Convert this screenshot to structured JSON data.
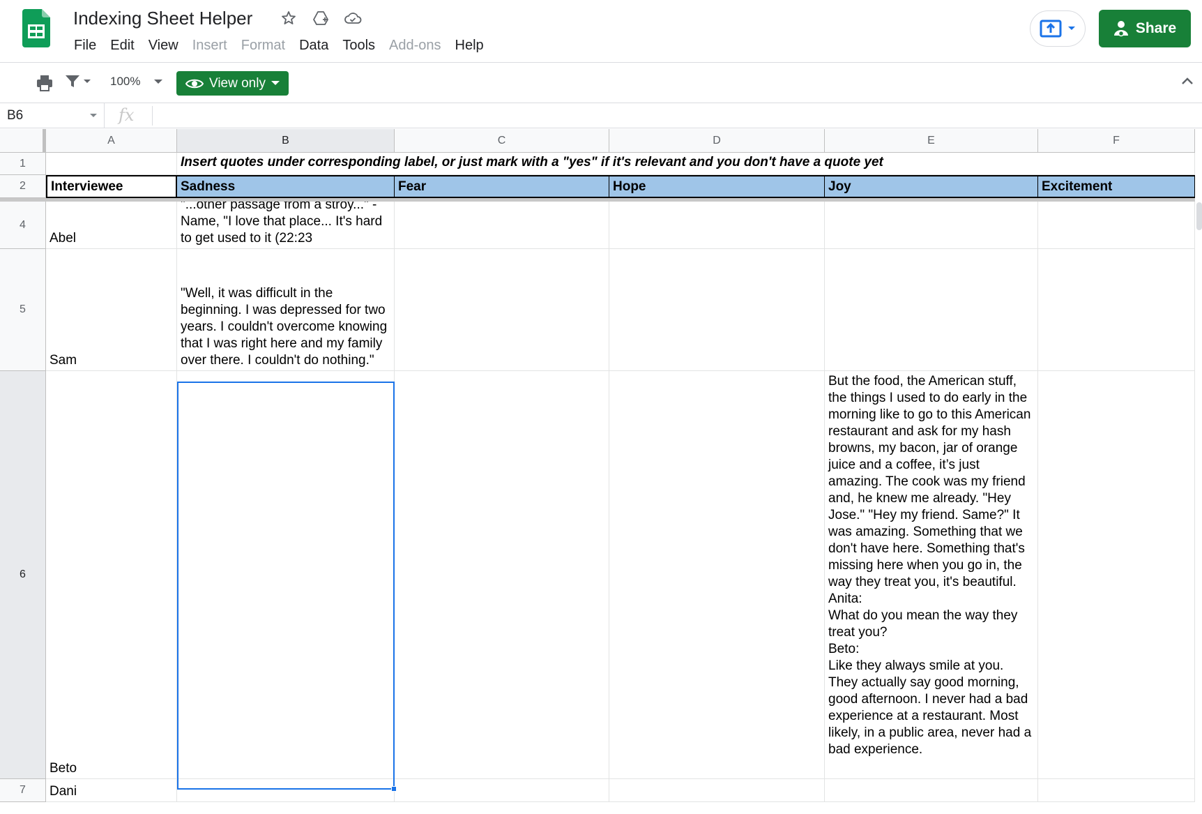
{
  "app": {
    "title": "Indexing Sheet Helper",
    "menus": [
      {
        "label": "File",
        "enabled": true
      },
      {
        "label": "Edit",
        "enabled": true
      },
      {
        "label": "View",
        "enabled": true
      },
      {
        "label": "Insert",
        "enabled": false
      },
      {
        "label": "Format",
        "enabled": false
      },
      {
        "label": "Data",
        "enabled": true
      },
      {
        "label": "Tools",
        "enabled": true
      },
      {
        "label": "Add-ons",
        "enabled": false
      },
      {
        "label": "Help",
        "enabled": true
      }
    ],
    "share_label": "Share",
    "brand_color": "#188038",
    "accent_color": "#1a73e8"
  },
  "toolbar": {
    "zoom": "100%",
    "mode_label": "View only"
  },
  "formula_bar": {
    "cell_ref": "B6",
    "fx_label": "fx",
    "formula": ""
  },
  "sheet": {
    "columns": [
      "A",
      "B",
      "C",
      "D",
      "E",
      "F"
    ],
    "selected_column": "B",
    "row_numbers": [
      "1",
      "2",
      "4",
      "5",
      "6",
      "7"
    ],
    "selected_row": "6",
    "row1_note": "Insert quotes under corresponding label,  or just mark with a \"yes\" if it's relevant and you don't have a quote yet",
    "headers": {
      "a": "Interviewee",
      "b": "Sadness",
      "c": "Fear",
      "d": "Hope",
      "e": "Joy",
      "f": "Excitement"
    },
    "rows": [
      {
        "a": "Abel",
        "b": "\"...other passage from a stroy...\" - Name, \"I love that place... It's hard to get used to it (22:23",
        "e": ""
      },
      {
        "a": "Sam",
        "b": "\"Well, it was difficult in the beginning. I was depressed for two years. I couldn't overcome knowing that I was right here and my family over there. I couldn't do nothing.\"",
        "e": ""
      },
      {
        "a": "Beto",
        "b": "",
        "e": "But the food, the American stuff, the things I used to do early in the morning like to go to this American restaurant and ask for my hash browns, my bacon, jar of orange juice and a coffee, it’s just amazing. The cook was my friend and, he knew me already. \"Hey Jose.\" \"Hey my friend. Same?\" It was amazing. Something that we don't have here. Something that's missing here when you go in, the way they treat you, it's beautiful.\nAnita:\nWhat do you mean the way they treat you?\nBeto:\nLike they always smile at you. They actually say good morning, good afternoon. I never had a bad experience at a restaurant. Most likely, in a public area, never had a bad experience."
      },
      {
        "a": "Dani",
        "b": "",
        "e": ""
      }
    ],
    "header_fill_color": "#9fc5e8"
  },
  "icons": {
    "logo": "google-sheets-logo",
    "star": "star-icon",
    "drive": "move-to-drive-icon",
    "cloud": "cloud-saved-icon",
    "present": "present-icon",
    "share": "share-person-icon",
    "print": "print-icon",
    "filter": "filter-icon",
    "eye": "eye-icon"
  }
}
